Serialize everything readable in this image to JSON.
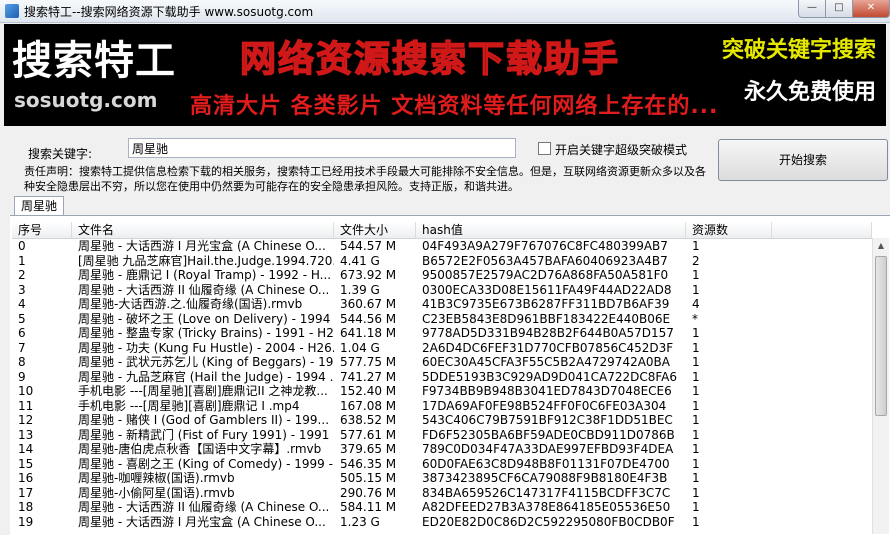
{
  "window": {
    "title": "搜索特工--搜索网络资源下载助手  www.sosuotg.com",
    "min_label": "—",
    "max_label": "□",
    "close_label": "✕"
  },
  "banner": {
    "logo": "搜索特工",
    "site": "sosuotg.com",
    "slogan": "网络资源搜索下载助手",
    "subline": "高清大片  各类影片  文档资料等任何网络上存在的...",
    "right_line1": "突破关键字搜索",
    "right_line2": "永久免费使用"
  },
  "search": {
    "label": "搜索关键字:",
    "value": "周星驰",
    "checkbox_label": "开启关键字超级突破模式",
    "button_label": "开始搜索"
  },
  "disclaimer": "责任声明：搜索特工提供信息检索下载的相关服务，搜索特工已经用技术手段最大可能排除不安全信息。但是，互联网络资源更新众多以及各种安全隐患层出不穷，所以您在使用中仍然要为可能存在的安全隐患承担风险。支持正版，和谐共进。",
  "tabs": [
    {
      "label": "周星驰"
    }
  ],
  "table": {
    "headers": [
      "序号",
      "文件名",
      "文件大小",
      "hash值",
      "资源数",
      ""
    ],
    "rows": [
      [
        "0",
        "周星驰 - 大话西游 I 月光宝盒 (A Chinese O...",
        "544.57 M",
        "04F493A9A279F767076C8FC480399AB7",
        "1"
      ],
      [
        "1",
        "[周星驰 九品芝麻官]Hail.the.Judge.1994.720...",
        "4.41 G",
        "B6572E2F0563A457BAFA60406923A4B7",
        "2"
      ],
      [
        "2",
        "周星驰 - 鹿鼎记 I (Royal Tramp) - 1992 - H...",
        "673.92 M",
        "9500857E2579AC2D76A868FA50A581F0",
        "1"
      ],
      [
        "3",
        "周星驰 - 大话西游 II 仙履奇缘 (A Chinese O...",
        "1.39 G",
        "0300ECA33D08E15611FA49F44AD22AD8",
        "1"
      ],
      [
        "4",
        "周星驰-大话西游.之.仙履奇缘(国语).rmvb",
        "360.67 M",
        "41B3C9735E673B6287FF311BD7B6AF39",
        "4"
      ],
      [
        "5",
        "周星驰 - 破坏之王 (Love on Delivery) - 1994 ...",
        "544.56 M",
        "C23EB5843E8D961BBF183422E440B06E",
        "*"
      ],
      [
        "6",
        "周星驰 - 整蛊专家 (Tricky Brains) - 1991 - H2...",
        "641.18 M",
        "9778AD5D331B94B28B2F644B0A57D157",
        "1"
      ],
      [
        "7",
        "周星驰 - 功夫 (Kung Fu Hustle) - 2004 - H26...",
        "1.04 G",
        "2A6D4DC6FEF31D770CFB07856C452D3F",
        "1"
      ],
      [
        "8",
        "周星驰 - 武状元苏乞儿 (King of Beggars) - 19...",
        "577.75 M",
        "60EC30A45CFA3F55C5B2A4729742A0BA",
        "1"
      ],
      [
        "9",
        "周星驰 - 九品芝麻官 (Hail the Judge) - 1994 ...",
        "741.27 M",
        "5DDE5193B3C929AD9D041CA722DC8FA6",
        "1"
      ],
      [
        "10",
        "手机电影 ---[周星驰][喜剧]鹿鼎记II 之神龙教...",
        "152.40 M",
        "F9734BB9B948B3041ED7843D7048ECE6",
        "1"
      ],
      [
        "11",
        "手机电影 ---[周星驰][喜剧]鹿鼎记 I .mp4",
        "167.08 M",
        "17DA69AF0FE98B524FF0F0C6FE03A304",
        "1"
      ],
      [
        "12",
        "周星驰 - 赌侠 I (God of Gamblers II) - 199...",
        "638.52 M",
        "543C406C79B7591BF912C38F1DD51BEC",
        "1"
      ],
      [
        "13",
        "周星驰 - 新精武门 (Fist of Fury 1991) - 1991 ...",
        "577.61 M",
        "FD6F52305BA6BF59ADE0CBD911D0786B",
        "1"
      ],
      [
        "14",
        "周星驰-唐伯虎点秋香【国语中文字幕】.rmvb",
        "379.65 M",
        "789C0D034F47A33DAE997EFBD93F4DEA",
        "1"
      ],
      [
        "15",
        "周星驰 - 喜剧之王 (King of Comedy) - 1999 -...",
        "546.35 M",
        "60D0FAE63C8D948B8F01131F07DE4700",
        "1"
      ],
      [
        "16",
        "周星驰-咖喱辣椒(国语).rmvb",
        "505.15 M",
        "3873423895CF6CA79088F9B8180E4F3B",
        "1"
      ],
      [
        "17",
        "周星驰-小偷阿星(国语).rmvb",
        "290.76 M",
        "834BA659526C147317F4115BCDFF3C7C",
        "1"
      ],
      [
        "18",
        "周星驰 - 大话西游 II 仙履奇缘 (A Chinese O...",
        "584.11 M",
        "A82DFEED27B3A378E864185E05536E50",
        "1"
      ],
      [
        "19",
        "周星驰 - 大话西游 I 月光宝盒 (A Chinese O...",
        "1.23 G",
        "ED20E82D0C86D2C592295080FB0CDB0F",
        "1"
      ]
    ]
  },
  "scrollbar": {
    "up_arrow": "▲"
  },
  "icons": [
    "app-icon"
  ]
}
